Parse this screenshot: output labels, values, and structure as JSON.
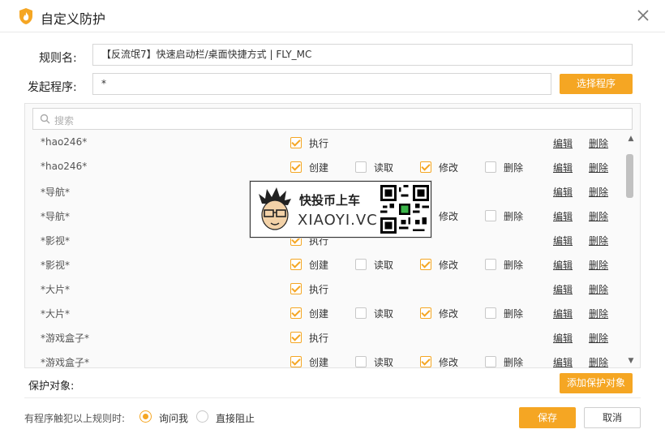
{
  "window": {
    "title": "自定义防护"
  },
  "form": {
    "rule_name_label": "规则名:",
    "rule_name_value": "【反流氓7】快速启动栏/桌面快捷方式 | FLY_MC",
    "initiator_label": "发起程序:",
    "initiator_value": "*",
    "select_program_button": "选择程序"
  },
  "search": {
    "placeholder": "搜索"
  },
  "rows": [
    {
      "name": "*hao246*",
      "type": "exec"
    },
    {
      "name": "*hao246*",
      "type": "full"
    },
    {
      "name": "*导航*",
      "type": "exec"
    },
    {
      "name": "*导航*",
      "type": "full"
    },
    {
      "name": "*影视*",
      "type": "exec"
    },
    {
      "name": "*影视*",
      "type": "full"
    },
    {
      "name": "*大片*",
      "type": "exec"
    },
    {
      "name": "*大片*",
      "type": "full"
    },
    {
      "name": "*游戏盒子*",
      "type": "exec"
    },
    {
      "name": "*游戏盒子*",
      "type": "full"
    }
  ],
  "row_labels": {
    "exec": "执行",
    "create": "创建",
    "read": "读取",
    "modify": "修改",
    "delete": "删除",
    "edit_link": "编辑",
    "delete_link": "删除"
  },
  "protect": {
    "label": "保护对象:",
    "add_button": "添加保护对象"
  },
  "footer": {
    "trigger_label": "有程序触犯以上规则时:",
    "option_ask": "询问我",
    "option_block": "直接阻止",
    "selected": "ask",
    "save_button": "保存",
    "cancel_button": "取消"
  },
  "overlay_ad": {
    "line1": "快投币上车",
    "line2": "XIAOYI.VC"
  },
  "colors": {
    "accent": "#f5a623",
    "text": "#333333"
  }
}
